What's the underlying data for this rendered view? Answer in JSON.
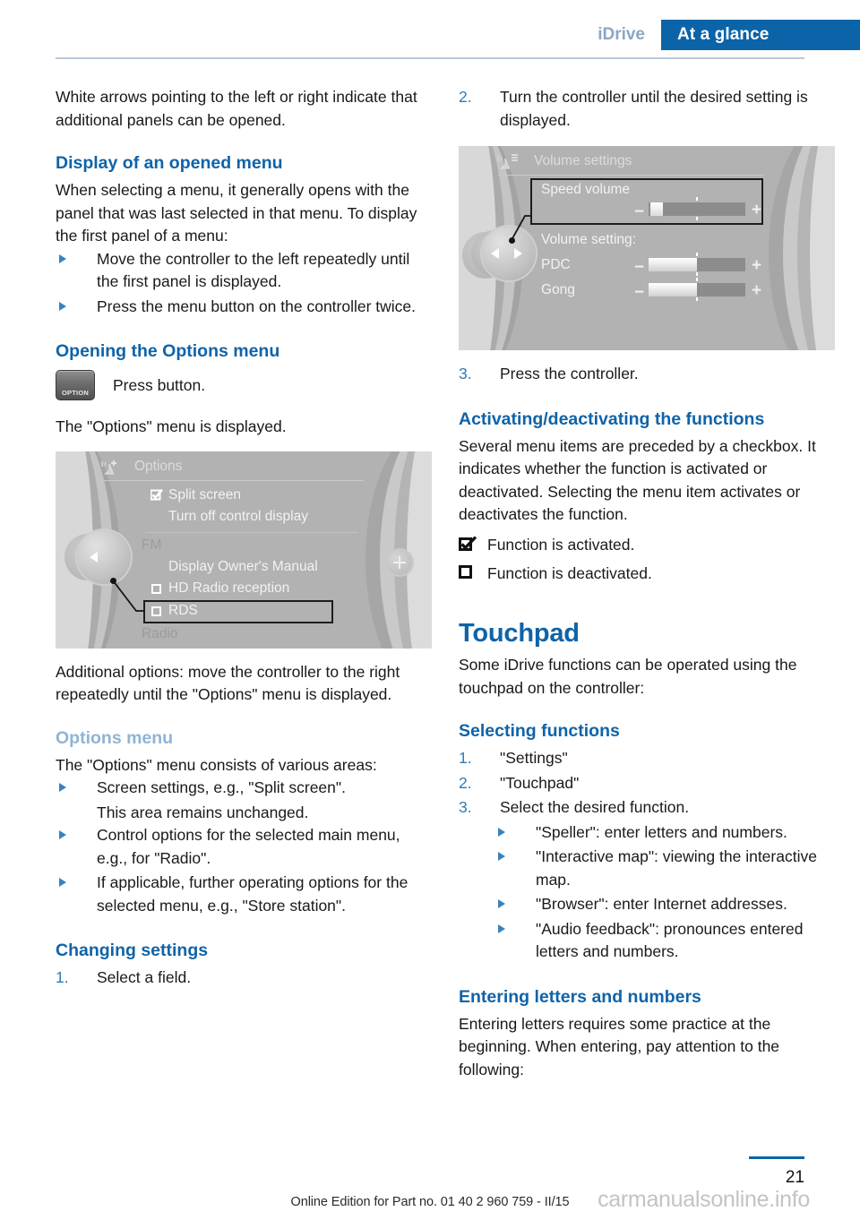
{
  "header": {
    "section": "iDrive",
    "chapter": "At a glance"
  },
  "left_column": {
    "intro_paragraph": "White arrows pointing to the left or right indicate that additional panels can be opened.",
    "heading_display_menu": "Display of an opened menu",
    "display_menu_paragraph": "When selecting a menu, it generally opens with the panel that was last selected in that menu. To display the first panel of a menu:",
    "display_menu_bullets": [
      "Move the controller to the left repeatedly until the first panel is displayed.",
      "Press the menu button on the controller twice."
    ],
    "heading_opening_options": "Opening the Options menu",
    "option_button_label": "OPTION",
    "option_button_text": "Press button.",
    "options_displayed_text": "The \"Options\" menu is displayed.",
    "additional_options_paragraph": "Additional options: move the controller to the right repeatedly until the \"Options\" menu is displayed.",
    "heading_options_menu": "Options menu",
    "options_menu_paragraph": "The \"Options\" menu consists of various areas:",
    "options_menu_bullets": [
      "Screen settings, e.g., \"Split screen\".",
      "Control options for the selected main menu, e.g., for \"Radio\".",
      "If applicable, further operating options for the selected menu, e.g., \"Store station\"."
    ],
    "options_menu_sub_note": "This area remains unchanged.",
    "heading_changing_settings": "Changing settings",
    "changing_settings_step1_number": "1.",
    "changing_settings_step1": "Select a field."
  },
  "options_screen": {
    "title": "Options",
    "items": [
      {
        "label": "Split screen",
        "checkbox": "checked"
      },
      {
        "label": "Turn off control display",
        "checkbox": "none"
      },
      {
        "label": "FM",
        "checkbox": "none",
        "dim": true
      },
      {
        "label": "Display Owner's Manual",
        "checkbox": "none"
      },
      {
        "label": "HD Radio reception",
        "checkbox": "unchecked"
      },
      {
        "label": "RDS",
        "checkbox": "unchecked",
        "highlighted": true
      },
      {
        "label": "Radio",
        "checkbox": "none",
        "dim": true
      }
    ]
  },
  "volume_screen": {
    "title": "Volume settings",
    "highlighted_item": "Speed volume",
    "group_label": "Volume setting:",
    "sliders": [
      {
        "label": "Speed volume",
        "minus": "−",
        "plus": "+",
        "fill_percent": 8
      },
      {
        "label": "PDC",
        "minus": "−",
        "plus": "+",
        "fill_percent": 50
      },
      {
        "label": "Gong",
        "minus": "−",
        "plus": "+",
        "fill_percent": 50
      }
    ]
  },
  "right_column": {
    "step2_number": "2.",
    "step2_text": "Turn the controller until the desired setting is displayed.",
    "step3_number": "3.",
    "step3_text": "Press the controller.",
    "heading_activating": "Activating/deactivating the functions",
    "activating_paragraph": "Several menu items are preceded by a checkbox. It indicates whether the function is activated or deactivated. Selecting the menu item activates or deactivates the function.",
    "checkbox_activated_text": "Function is activated.",
    "checkbox_deactivated_text": "Function is deactivated.",
    "heading_touchpad": "Touchpad",
    "touchpad_paragraph": "Some iDrive functions can be operated using the touchpad on the controller:",
    "heading_selecting_functions": "Selecting functions",
    "selecting_steps": [
      {
        "number": "1.",
        "text": "\"Settings\""
      },
      {
        "number": "2.",
        "text": "\"Touchpad\""
      },
      {
        "number": "3.",
        "text": "Select the desired function."
      }
    ],
    "selecting_sub_bullets": [
      "\"Speller\": enter letters and numbers.",
      "\"Interactive map\": viewing the interactive map.",
      "\"Browser\": enter Internet addresses.",
      "\"Audio feedback\": pronounces entered letters and numbers."
    ],
    "heading_entering": "Entering letters and numbers",
    "entering_paragraph": "Entering letters requires some practice at the beginning. When entering, pay attention to the following:"
  },
  "footer": {
    "note": "Online Edition for Part no. 01 40 2 960 759 - II/15",
    "page_number": "21",
    "watermark": "carmanualsonline.info"
  },
  "colors": {
    "accent_blue": "#0f63a8",
    "header_blue": "#0b64a8",
    "muted_blue": "#8fb4d4",
    "section_gray_blue": "#8aa7c4"
  }
}
